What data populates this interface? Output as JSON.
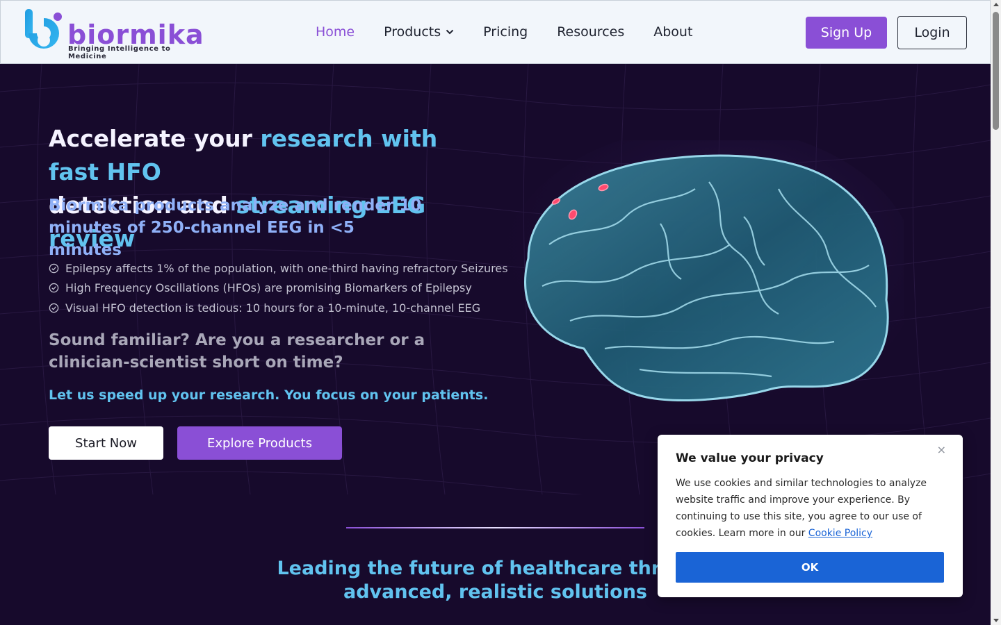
{
  "header": {
    "logo": {
      "word": "biormika",
      "tagline": "Bringing Intelligence to Medicine"
    },
    "nav": [
      {
        "label": "Home",
        "active": true
      },
      {
        "label": "Products",
        "has_dropdown": true
      },
      {
        "label": "Pricing"
      },
      {
        "label": "Resources"
      },
      {
        "label": "About"
      }
    ],
    "signup_label": "Sign Up",
    "login_label": "Login"
  },
  "hero": {
    "title_parts": [
      {
        "text": "Accelerate ",
        "highlight": false
      },
      {
        "text": "your ",
        "highlight": false
      },
      {
        "text": "research with fast HFO",
        "highlight": true
      },
      {
        "text": "detection and ",
        "highlight": false
      },
      {
        "text": "streaming EEG review",
        "highlight": true
      }
    ],
    "subtitle": "Biormika products analyze and render 10 minutes of 250-channel EEG in <5 minutes",
    "bullets": [
      "Epilepsy affects 1% of the population, with one-third having refractory Seizures",
      "High Frequency Oscillations (HFOs) are promising Biomarkers of Epilepsy",
      "Visual HFO detection is tedious: 10 hours for a 10-minute, 10-channel EEG"
    ],
    "question": "Sound familiar? Are you a researcher or a clinician-scientist short on time?",
    "tagline": "Let us speed up your research. You focus on your patients.",
    "start_label": "Start Now",
    "explore_label": "Explore Products"
  },
  "lead": {
    "line1": "Leading the future of healthcare through",
    "line2": "advanced, realistic solutions"
  },
  "cookie": {
    "title": "We value your privacy",
    "text": "We use cookies and similar technologies to analyze website traffic and improve your experience. By continuing to use this site, you agree to our use of cookies. Learn more in our",
    "link": "Cookie Policy",
    "close": "×",
    "ok_label": "OK"
  },
  "colors": {
    "brand": "#8a4fd6",
    "accent": "#61c3ef",
    "hero_bg": "#170a2c",
    "cookie_button": "#1a64d6"
  }
}
